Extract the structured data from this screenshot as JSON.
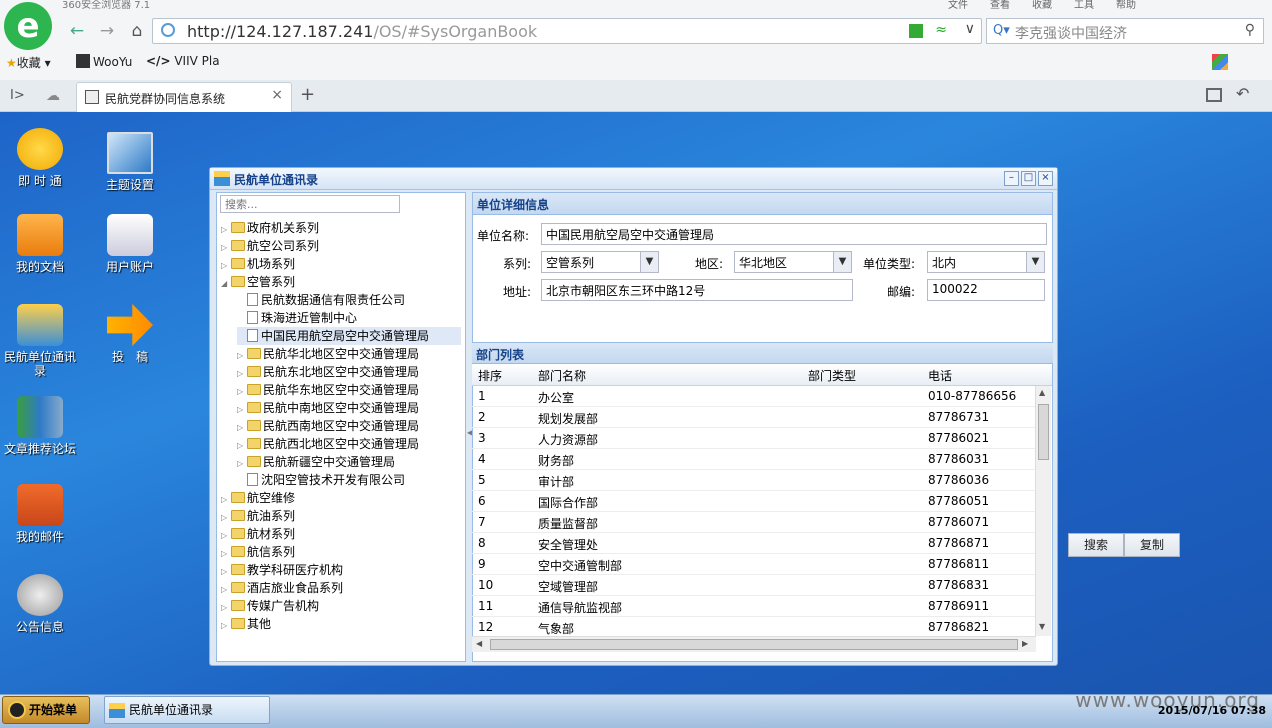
{
  "browser": {
    "app_title": "360安全浏览器 7.1",
    "menu": [
      "文件",
      "查看",
      "收藏",
      "工具",
      "帮助"
    ],
    "url_host": "http://124.127.187.241",
    "url_path": "/OS/#SysOrganBook",
    "search_placeholder": "李克强谈中国经济",
    "favorites_label": "收藏",
    "bookmarks": [
      "WooYu",
      "VIIV Pla"
    ],
    "tab_title": "民航党群协同信息系统",
    "tab_close": "×",
    "new_tab": "+"
  },
  "desktop": {
    "icons": [
      {
        "label": "即 时 通",
        "icon": "chat-icon"
      },
      {
        "label": "主题设置",
        "icon": "monitor-icon"
      },
      {
        "label": "我的文档",
        "icon": "folder-icon"
      },
      {
        "label": "用户账户",
        "icon": "user-icon"
      },
      {
        "label": "民航单位通讯录",
        "icon": "org-chart-icon"
      },
      {
        "label": "投　稿",
        "icon": "arrow-icon"
      },
      {
        "label": "文章推荐论坛",
        "icon": "books-icon"
      },
      {
        "label": "我的邮件",
        "icon": "mailbox-icon"
      },
      {
        "label": "公告信息",
        "icon": "megaphone-icon"
      }
    ],
    "search_button": "搜索",
    "copy_button": "复制"
  },
  "window": {
    "title": "民航单位通讯录",
    "tree_search_placeholder": "搜索...",
    "tree": [
      {
        "label": "政府机关系列",
        "type": "folder",
        "expanded": false,
        "level": 0
      },
      {
        "label": "航空公司系列",
        "type": "folder",
        "expanded": false,
        "level": 0
      },
      {
        "label": "机场系列",
        "type": "folder",
        "expanded": false,
        "level": 0
      },
      {
        "label": "空管系列",
        "type": "folder",
        "expanded": true,
        "level": 0
      },
      {
        "label": "民航数据通信有限责任公司",
        "type": "file",
        "level": 1
      },
      {
        "label": "珠海进近管制中心",
        "type": "file",
        "level": 1
      },
      {
        "label": "中国民用航空局空中交通管理局",
        "type": "file",
        "level": 1,
        "selected": true
      },
      {
        "label": "民航华北地区空中交通管理局",
        "type": "folder",
        "expanded": false,
        "level": 1
      },
      {
        "label": "民航东北地区空中交通管理局",
        "type": "folder",
        "expanded": false,
        "level": 1
      },
      {
        "label": "民航华东地区空中交通管理局",
        "type": "folder",
        "expanded": false,
        "level": 1
      },
      {
        "label": "民航中南地区空中交通管理局",
        "type": "folder",
        "expanded": false,
        "level": 1
      },
      {
        "label": "民航西南地区空中交通管理局",
        "type": "folder",
        "expanded": false,
        "level": 1
      },
      {
        "label": "民航西北地区空中交通管理局",
        "type": "folder",
        "expanded": false,
        "level": 1
      },
      {
        "label": "民航新疆空中交通管理局",
        "type": "folder",
        "expanded": false,
        "level": 1
      },
      {
        "label": "沈阳空管技术开发有限公司",
        "type": "file",
        "level": 1
      },
      {
        "label": "航空维修",
        "type": "folder",
        "expanded": false,
        "level": 0
      },
      {
        "label": "航油系列",
        "type": "folder",
        "expanded": false,
        "level": 0
      },
      {
        "label": "航材系列",
        "type": "folder",
        "expanded": false,
        "level": 0
      },
      {
        "label": "航信系列",
        "type": "folder",
        "expanded": false,
        "level": 0
      },
      {
        "label": "教学科研医疗机构",
        "type": "folder",
        "expanded": false,
        "level": 0
      },
      {
        "label": "酒店旅业食品系列",
        "type": "folder",
        "expanded": false,
        "level": 0
      },
      {
        "label": "传媒广告机构",
        "type": "folder",
        "expanded": false,
        "level": 0
      },
      {
        "label": "其他",
        "type": "folder",
        "expanded": false,
        "level": 0
      }
    ],
    "detail": {
      "header": "单位详细信息",
      "name_label": "单位名称:",
      "name_value": "中国民用航空局空中交通管理局",
      "series_label": "系列:",
      "series_value": "空管系列",
      "region_label": "地区:",
      "region_value": "华北地区",
      "type_label": "单位类型:",
      "type_value": "北内",
      "address_label": "地址:",
      "address_value": "北京市朝阳区东三环中路12号",
      "zip_label": "邮编:",
      "zip_value": "100022"
    },
    "departments": {
      "header": "部门列表",
      "columns": [
        "排序",
        "部门名称",
        "部门类型",
        "电话"
      ],
      "rows": [
        [
          "1",
          "办公室",
          "",
          "010-87786656"
        ],
        [
          "2",
          "规划发展部",
          "",
          "87786731"
        ],
        [
          "3",
          "人力资源部",
          "",
          "87786021"
        ],
        [
          "4",
          "财务部",
          "",
          "87786031"
        ],
        [
          "5",
          "审计部",
          "",
          "87786036"
        ],
        [
          "6",
          "国际合作部",
          "",
          "87786051"
        ],
        [
          "7",
          "质量监督部",
          "",
          "87786071"
        ],
        [
          "8",
          "安全管理处",
          "",
          "87786871"
        ],
        [
          "9",
          "空中交通管制部",
          "",
          "87786811"
        ],
        [
          "10",
          "空域管理部",
          "",
          "87786831"
        ],
        [
          "11",
          "通信导航监视部",
          "",
          "87786911"
        ],
        [
          "12",
          "气象部",
          "",
          "87786821"
        ]
      ]
    }
  },
  "taskbar": {
    "start_label": "开始菜单",
    "task_label": "民航单位通讯录",
    "clock": "2015/07/16 07:38",
    "watermark": "www.wooyun.org"
  }
}
